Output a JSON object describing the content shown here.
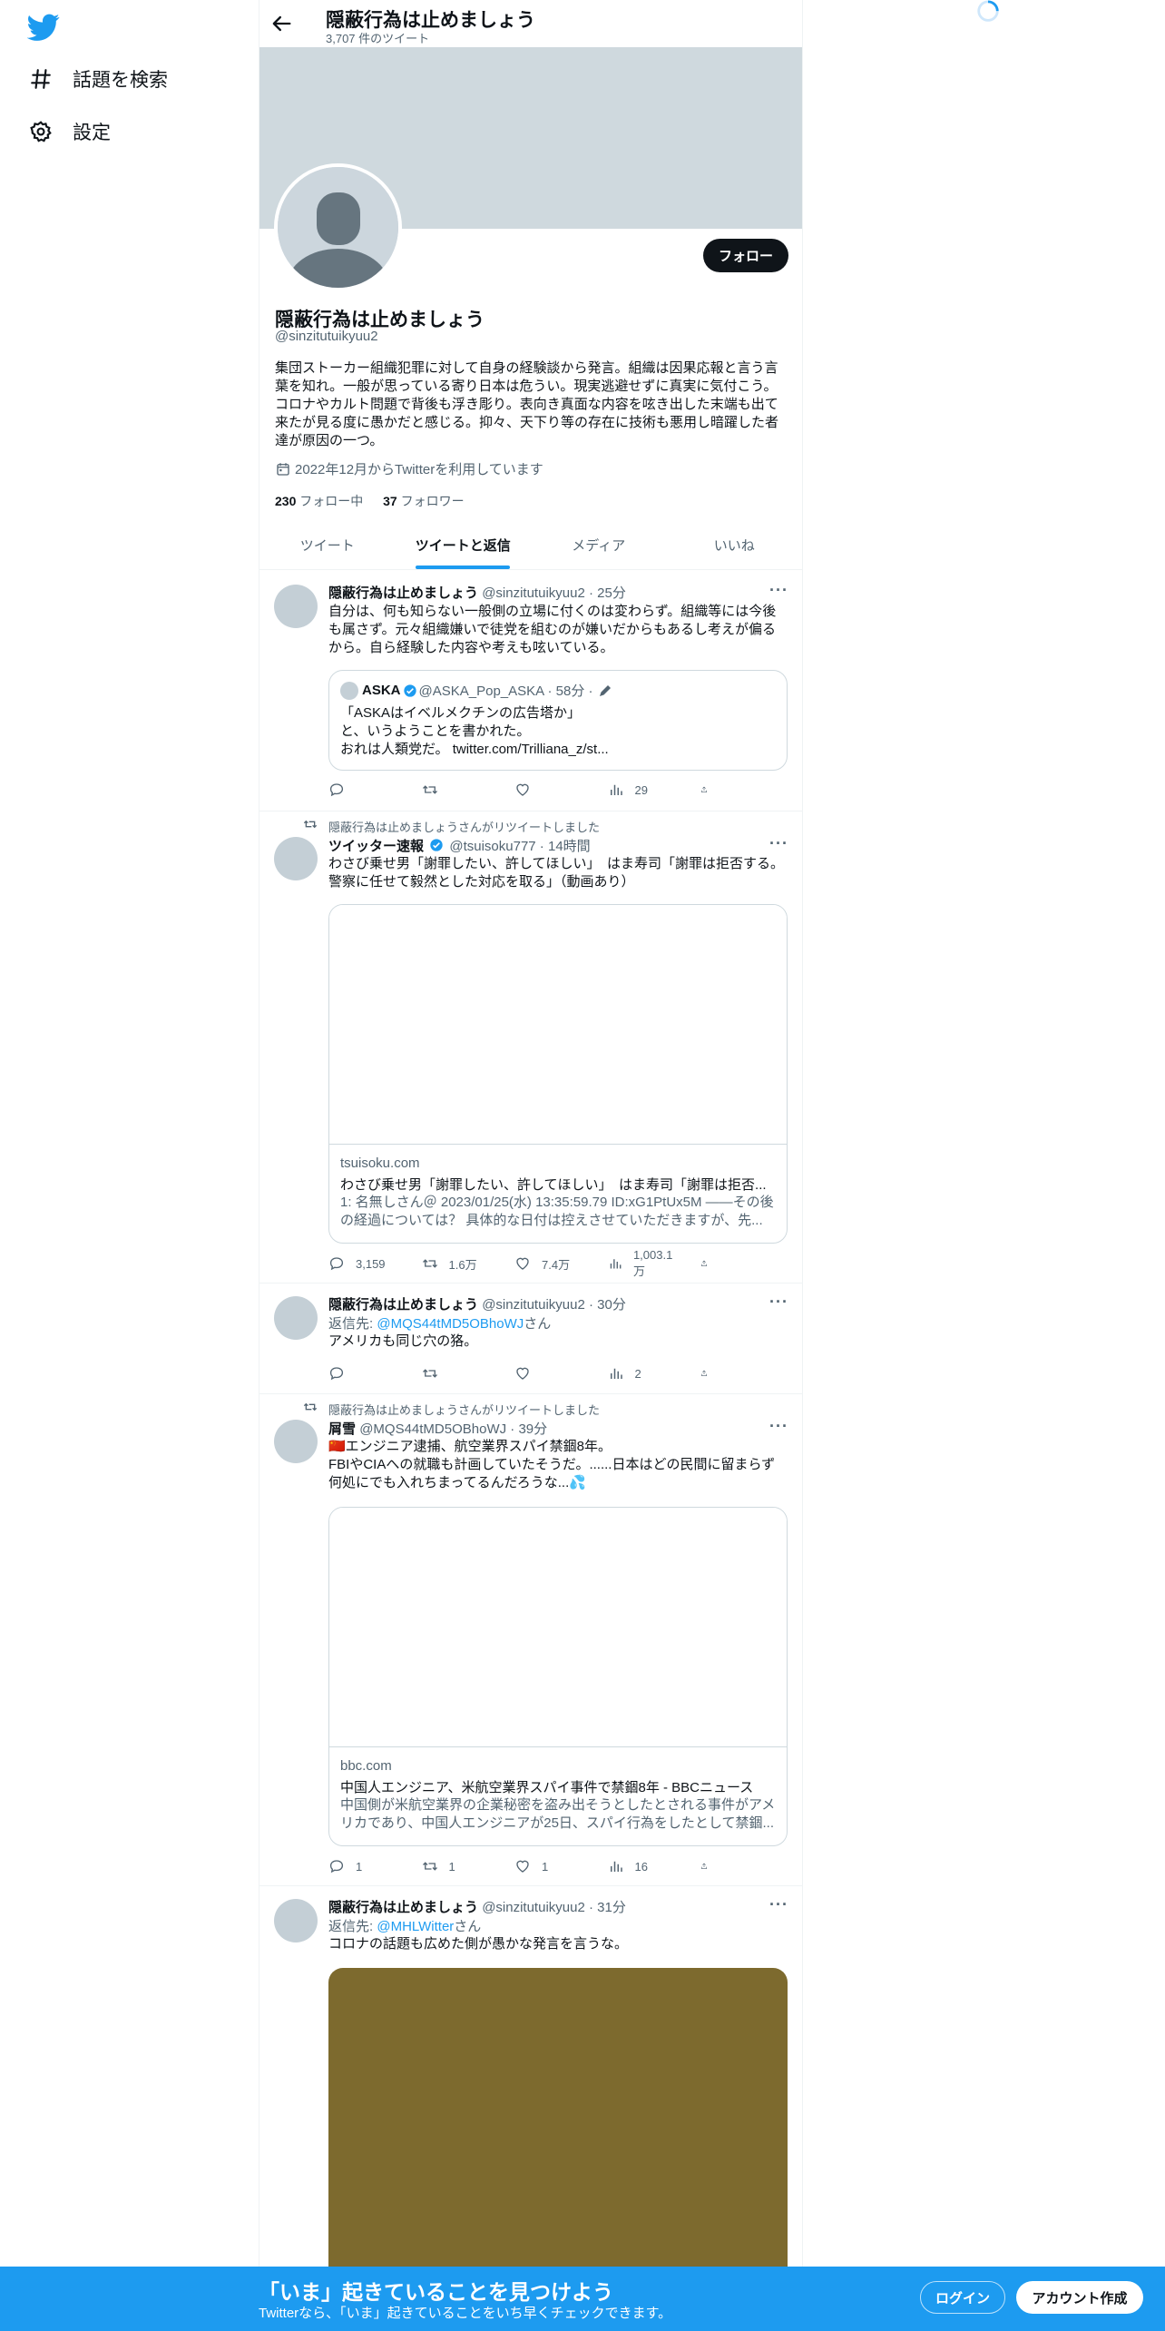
{
  "nav": {
    "explore_label": "話題を検索",
    "settings_label": "設定"
  },
  "header": {
    "title": "隠蔽行為は止めましょう",
    "tweet_count": "3,707 件のツイート"
  },
  "profile": {
    "follow_label": "フォロー",
    "name": "隠蔽行為は止めましょう",
    "handle": "@sinzitutuikyuu2",
    "bio": "集団ストーカー組織犯罪に対して自身の経験談から発言。組織は因果応報と言う言葉を知れ。一般が思っている寄り日本は危うい。現実逃避せずに真実に気付こう。コロナやカルト問題で背後も浮き彫り。表向き真面な内容を呟き出した末端も出て来たが見る度に愚かだと感じる。抑々、天下り等の存在に技術も悪用し暗躍した者達が原因の一つ。",
    "joined": "2022年12月からTwitterを利用しています",
    "following_count": "230",
    "following_label": "フォロー中",
    "followers_count": "37",
    "followers_label": "フォロワー"
  },
  "tabs": [
    "ツイート",
    "ツイートと返信",
    "メディア",
    "いいね"
  ],
  "tweets": [
    {
      "name": "隠蔽行為は止めましょう",
      "meta": "@sinzitutuikyuu2 · 25分",
      "text": "自分は、何も知らない一般側の立場に付くのは変わらず。組織等には今後も属さず。元々組織嫌いで徒党を組むのが嫌いだからもあるし考えが偏るから。自ら経験した内容や考えも呟いている。",
      "quote": {
        "name": "ASKA",
        "meta": "@ASKA_Pop_ASKA · 58分 ·",
        "text": "「ASKAはイベルメクチンの広告塔か」\nと、いうようことを書かれた。\nおれは人類党だ。 twitter.com/Trilliana_z/st..."
      },
      "views": "29"
    },
    {
      "retweet_line": "隠蔽行為は止めましょうさんがリツイートしました",
      "name": "ツイッター速報",
      "meta": "@tsuisoku777 · 14時間",
      "text": "わさび乗せ男「謝罪したい、許してほしい」　はま寿司「謝罪は拒否する。警察に任せて毅然とした対応を取る」（動画あり）",
      "card": {
        "domain": "tsuisoku.com",
        "title": "わさび乗せ男「謝罪したい、許してほしい」　はま寿司「謝罪は拒否...",
        "desc": "1: 名無しさん＠ 2023/01/25(水) 13:35:59.79 ID:xG1PtUx5M ——その後の経過については？ 具体的な日付は控えさせていただきますが、先..."
      },
      "replies": "3,159",
      "retweets": "1.6万",
      "likes": "7.4万",
      "views": "1,003.1万"
    },
    {
      "name": "隠蔽行為は止めましょう",
      "meta": "@sinzitutuikyuu2 · 30分",
      "reply_prefix": "返信先: ",
      "reply_to": "@MQS44tMD5OBhoWJ",
      "reply_suffix": "さん",
      "text": "アメリカも同じ穴の狢。",
      "views": "2"
    },
    {
      "retweet_line": "隠蔽行為は止めましょうさんがリツイートしました",
      "name": "屑雪",
      "meta": "@MQS44tMD5OBhoWJ · 39分",
      "text": "🇨🇳エンジニア逮捕、航空業界スパイ禁錮8年。\nFBIやCIAへの就職も計画していたそうだ。......日本はどの民間に留まらず何処にでも入れちまってるんだろうな...💦",
      "card": {
        "domain": "bbc.com",
        "title": "中国人エンジニア、米航空業界スパイ事件で禁錮8年 - BBCニュース",
        "desc": "中国側が米航空業界の企業秘密を盗み出そうとしたとされる事件がアメリカであり、中国人エンジニアが25日、スパイ行為をしたとして禁錮..."
      },
      "replies": "1",
      "retweets": "1",
      "likes": "1",
      "views": "16"
    },
    {
      "name": "隠蔽行為は止めましょう",
      "meta": "@sinzitutuikyuu2 · 31分",
      "reply_prefix": "返信先: ",
      "reply_to": "@MHLWitter",
      "reply_suffix": "さん",
      "text": "コロナの話題も広めた側が愚かな発言を言うな。"
    }
  ],
  "bottom_bar": {
    "title": "「いま」起きていることを見つけよう",
    "subtitle": "Twitterなら、「いま」起きていることをいち早くチェックできます。",
    "login_label": "ログイン",
    "signup_label": "アカウント作成"
  },
  "colors": {
    "accent": "#1d9bf0",
    "text": "#0f1419",
    "secondary": "#536471",
    "banner": "#cfd9de"
  }
}
